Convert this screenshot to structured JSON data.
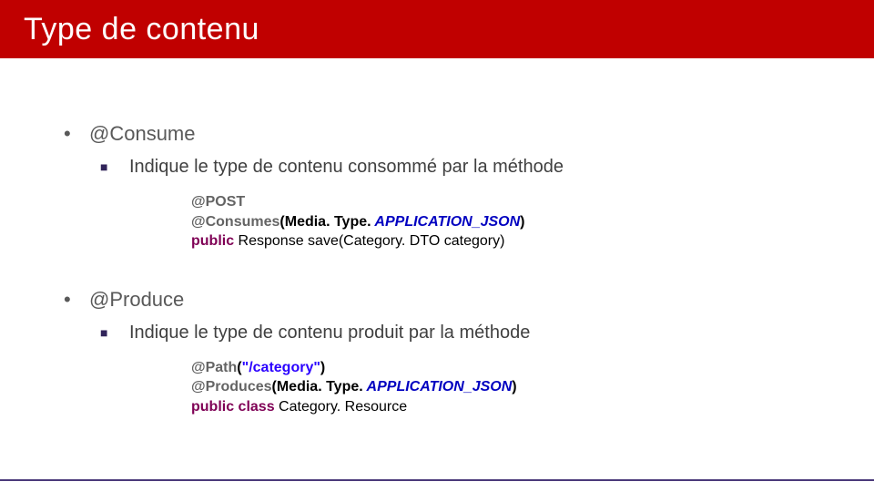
{
  "title": "Type de contenu",
  "sections": [
    {
      "heading": "@Consume",
      "sub": "Indique le type de contenu consommé par la méthode",
      "code": {
        "l1_ann": "@POST",
        "l2_ann": "@Consumes",
        "l2_open": "(",
        "l2_media": "Media. Type.",
        "l2_const": " APPLICATION_JSON",
        "l2_close": ")",
        "l3_kw": "public",
        "l3_rest": " Response save(Category. DTO category)"
      }
    },
    {
      "heading": "@Produce",
      "sub": "Indique le type de contenu produit par la méthode",
      "code": {
        "l1_ann": "@Path",
        "l1_open": "(",
        "l1_str": "\"/category\"",
        "l1_close": ")",
        "l2_ann": "@Produces",
        "l2_open": "(",
        "l2_media": "Media. Type.",
        "l2_const": " APPLICATION_JSON",
        "l2_close": ")",
        "l3_kw1": "public",
        "l3_kw2": " class",
        "l3_rest": " Category. Resource"
      }
    }
  ]
}
